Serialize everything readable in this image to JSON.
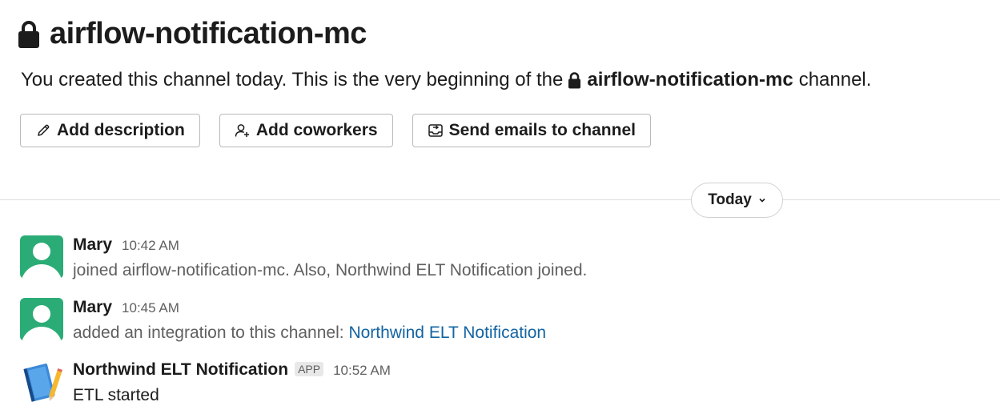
{
  "channel": {
    "name": "airflow-notification-mc",
    "intro_prefix": "You created this channel today. This is the very beginning of the",
    "intro_channel": "airflow-notification-mc",
    "intro_suffix": "channel."
  },
  "actions": [
    {
      "label": "Add description",
      "icon": "pencil-icon"
    },
    {
      "label": "Add coworkers",
      "icon": "add-person-icon"
    },
    {
      "label": "Send emails to channel",
      "icon": "email-inbox-icon"
    }
  ],
  "day_divider": {
    "label": "Today",
    "icon": "chevron-down-icon"
  },
  "messages": [
    {
      "sender": "Mary",
      "time": "10:42 AM",
      "text": "joined airflow-notification-mc. Also, Northwind ELT Notification joined."
    },
    {
      "sender": "Mary",
      "time": "10:45 AM",
      "text": "added an integration to this channel:",
      "link": "Northwind ELT Notification"
    },
    {
      "sender": "Northwind ELT Notification",
      "badge": "APP",
      "time": "10:52 AM",
      "text": "ETL started"
    }
  ],
  "colors": {
    "avatar_green": "#2bac76",
    "link_blue": "#1264a3",
    "text_primary": "#1d1c1d",
    "text_secondary": "#616061"
  }
}
